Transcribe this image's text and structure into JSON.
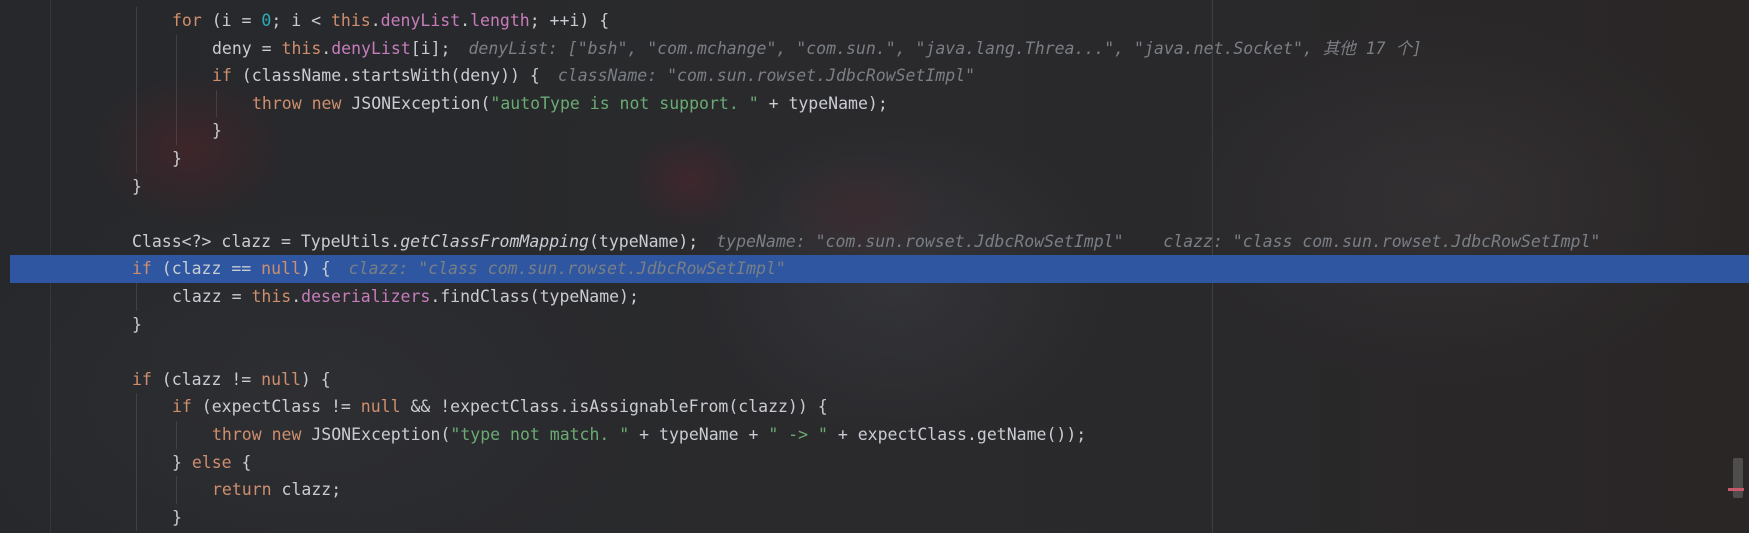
{
  "lines": [
    {
      "indent": 1,
      "tokens": [
        [
          "kw",
          "for"
        ],
        [
          "p",
          " (i = "
        ],
        [
          "num",
          "0"
        ],
        [
          "p",
          "; i < "
        ],
        [
          "kw",
          "this"
        ],
        [
          "p",
          "."
        ],
        [
          "fld",
          "denyList"
        ],
        [
          "p",
          "."
        ],
        [
          "fld",
          "length"
        ],
        [
          "p",
          "; ++i) {"
        ]
      ],
      "hint": ""
    },
    {
      "indent": 2,
      "tokens": [
        [
          "p",
          "deny = "
        ],
        [
          "kw",
          "this"
        ],
        [
          "p",
          "."
        ],
        [
          "fld",
          "denyList"
        ],
        [
          "p",
          "[i];"
        ]
      ],
      "hint": "denyList: [\"bsh\", \"com.mchange\", \"com.sun.\", \"java.lang.Threa...\", \"java.net.Socket\", 其他 17 个]"
    },
    {
      "indent": 2,
      "tokens": [
        [
          "kw",
          "if"
        ],
        [
          "p",
          " (className.startsWith(deny)) {"
        ]
      ],
      "hint": "className: \"com.sun.rowset.JdbcRowSetImpl\""
    },
    {
      "indent": 3,
      "tokens": [
        [
          "kw",
          "throw new"
        ],
        [
          "p",
          " JSONException("
        ],
        [
          "str",
          "\"autoType is not support. \""
        ],
        [
          "p",
          " + typeName);"
        ]
      ],
      "hint": ""
    },
    {
      "indent": 2,
      "tokens": [
        [
          "p",
          "}"
        ]
      ],
      "hint": ""
    },
    {
      "indent": 1,
      "tokens": [
        [
          "p",
          "}"
        ]
      ],
      "hint": ""
    },
    {
      "indent": 0,
      "tokens": [
        [
          "p",
          "}"
        ]
      ],
      "hint": ""
    },
    {
      "indent": 0,
      "tokens": [],
      "hint": ""
    },
    {
      "indent": 0,
      "tokens": [
        [
          "p",
          "Class<?> clazz = TypeUtils."
        ],
        [
          "mth",
          "getClassFromMapping"
        ],
        [
          "p",
          "(typeName);"
        ]
      ],
      "hint": "typeName: \"com.sun.rowset.JdbcRowSetImpl\"    clazz: \"class com.sun.rowset.JdbcRowSetImpl\""
    },
    {
      "indent": 0,
      "tokens": [
        [
          "kw",
          "if"
        ],
        [
          "p",
          " (clazz == "
        ],
        [
          "kw",
          "null"
        ],
        [
          "p",
          ") {"
        ]
      ],
      "hint": "clazz: \"class com.sun.rowset.JdbcRowSetImpl\"",
      "highlight": true
    },
    {
      "indent": 1,
      "tokens": [
        [
          "p",
          "clazz = "
        ],
        [
          "kw",
          "this"
        ],
        [
          "p",
          "."
        ],
        [
          "fld",
          "deserializers"
        ],
        [
          "p",
          ".findClass(typeName);"
        ]
      ],
      "hint": ""
    },
    {
      "indent": 0,
      "tokens": [
        [
          "p",
          "}"
        ]
      ],
      "hint": ""
    },
    {
      "indent": 0,
      "tokens": [],
      "hint": ""
    },
    {
      "indent": 0,
      "tokens": [
        [
          "kw",
          "if"
        ],
        [
          "p",
          " (clazz != "
        ],
        [
          "kw",
          "null"
        ],
        [
          "p",
          ") {"
        ]
      ],
      "hint": ""
    },
    {
      "indent": 1,
      "tokens": [
        [
          "kw",
          "if"
        ],
        [
          "p",
          " (expectClass != "
        ],
        [
          "kw",
          "null"
        ],
        [
          "p",
          " && !expectClass.isAssignableFrom(clazz)) {"
        ]
      ],
      "hint": ""
    },
    {
      "indent": 2,
      "tokens": [
        [
          "kw",
          "throw new"
        ],
        [
          "p",
          " JSONException("
        ],
        [
          "str",
          "\"type not match. \""
        ],
        [
          "p",
          " + typeName + "
        ],
        [
          "str",
          "\" -> \""
        ],
        [
          "p",
          " + expectClass.getName());"
        ]
      ],
      "hint": ""
    },
    {
      "indent": 1,
      "tokens": [
        [
          "p",
          "} "
        ],
        [
          "kw",
          "else"
        ],
        [
          "p",
          " {"
        ]
      ],
      "hint": ""
    },
    {
      "indent": 2,
      "tokens": [
        [
          "kw",
          "return"
        ],
        [
          "p",
          " clazz;"
        ]
      ],
      "hint": ""
    },
    {
      "indent": 1,
      "tokens": [
        [
          "p",
          "}"
        ]
      ],
      "hint": ""
    }
  ],
  "colors": {
    "keyword": "#cf8e6d",
    "field": "#c77dbb",
    "number": "#2aacb8",
    "string": "#6aab73",
    "hint": "#7a7e85",
    "selection": "#2f57a1"
  }
}
